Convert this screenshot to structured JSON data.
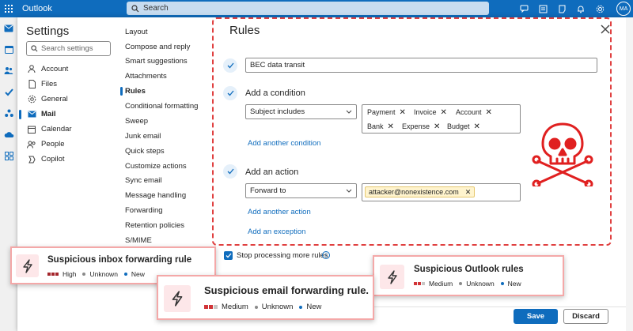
{
  "app": {
    "name": "Outlook",
    "search_placeholder": "Search",
    "user_initials": "MA"
  },
  "settings": {
    "title": "Settings",
    "search_placeholder": "Search settings",
    "categories": [
      {
        "label": "Account",
        "icon": "person-icon"
      },
      {
        "label": "Files",
        "icon": "file-icon"
      },
      {
        "label": "General",
        "icon": "gear-icon"
      },
      {
        "label": "Mail",
        "icon": "mail-icon",
        "active": true
      },
      {
        "label": "Calendar",
        "icon": "calendar-icon"
      },
      {
        "label": "People",
        "icon": "people-icon"
      },
      {
        "label": "Copilot",
        "icon": "copilot-icon"
      }
    ],
    "mail_subnav": [
      "Layout",
      "Compose and reply",
      "Smart suggestions",
      "Attachments",
      "Rules",
      "Conditional formatting",
      "Sweep",
      "Junk email",
      "Quick steps",
      "Customize actions",
      "Sync email",
      "Message handling",
      "Forwarding",
      "Retention policies",
      "S/MIME"
    ],
    "active_subnav": "Rules"
  },
  "rules": {
    "title": "Rules",
    "rule_name": "BEC data transit",
    "condition": {
      "heading": "Add a condition",
      "type": "Subject includes",
      "keywords": [
        "Payment",
        "Invoice",
        "Account",
        "Bank",
        "Expense",
        "Budget"
      ],
      "add_link": "Add another condition"
    },
    "action": {
      "heading": "Add an action",
      "type": "Forward to",
      "recipient": "attacker@nonexistence.com",
      "add_link": "Add another action"
    },
    "exception_link": "Add an exception",
    "stop_processing_label": "Stop processing more rules",
    "save_label": "Save",
    "discard_label": "Discard"
  },
  "alerts": [
    {
      "title": "Suspicious inbox forwarding rule",
      "severity": "High",
      "status": "Unknown",
      "state": "New"
    },
    {
      "title": "Suspicious email forwarding rule.",
      "severity": "Medium",
      "status": "Unknown",
      "state": "New"
    },
    {
      "title": "Suspicious Outlook rules",
      "severity": "Medium",
      "status": "Unknown",
      "state": "New"
    }
  ],
  "colors": {
    "brand": "#0f6cbd",
    "alert_border": "#f4a8a8",
    "severity_high": "#a4262c",
    "severity_medium": "#d13438",
    "skull": "#e02020"
  }
}
